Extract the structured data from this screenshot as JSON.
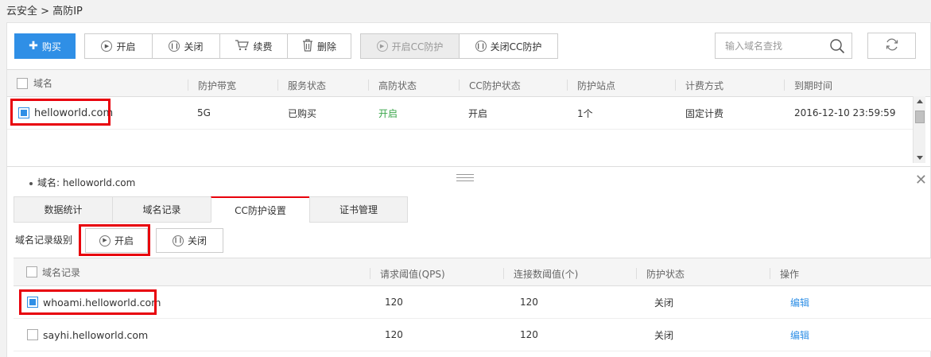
{
  "breadcrumb": {
    "root": "云安全",
    "sep": ">",
    "current": "高防IP"
  },
  "toolbar": {
    "buy": "购买",
    "enable": "开启",
    "disable": "关闭",
    "renew": "续费",
    "delete": "删除",
    "enable_cc": "开启CC防护",
    "disable_cc": "关闭CC防护",
    "search_placeholder": "输入域名查找"
  },
  "domain_table": {
    "headers": [
      "域名",
      "防护带宽",
      "服务状态",
      "高防状态",
      "CC防护状态",
      "防护站点",
      "计费方式",
      "到期时间"
    ],
    "rows": [
      {
        "domain": "helloworld.com",
        "bandwidth": "5G",
        "service": "已购买",
        "ddos": "开启",
        "cc": "开启",
        "sites": "1个",
        "billing": "固定计费",
        "expire": "2016-12-10 23:59:59",
        "checked": true
      }
    ]
  },
  "detail": {
    "domain_label": "域名: helloworld.com",
    "tabs": [
      "数据统计",
      "域名记录",
      "CC防护设置",
      "证书管理"
    ],
    "active_tab": "CC防护设置",
    "level_label": "域名记录级别",
    "enable": "开启",
    "disable": "关闭",
    "headers": [
      "域名记录",
      "请求阈值(QPS)",
      "连接数阈值(个)",
      "防护状态",
      "操作"
    ],
    "rows": [
      {
        "record": "whoami.helloworld.com",
        "qps": "120",
        "conn": "120",
        "status": "关闭",
        "action": "编辑",
        "checked": true
      },
      {
        "record": "sayhi.helloworld.com",
        "qps": "120",
        "conn": "120",
        "status": "关闭",
        "action": "编辑",
        "checked": false
      }
    ]
  },
  "colors": {
    "accent": "#2f8fe6",
    "highlight": "#e8000b",
    "on_green": "#3aa64a"
  }
}
